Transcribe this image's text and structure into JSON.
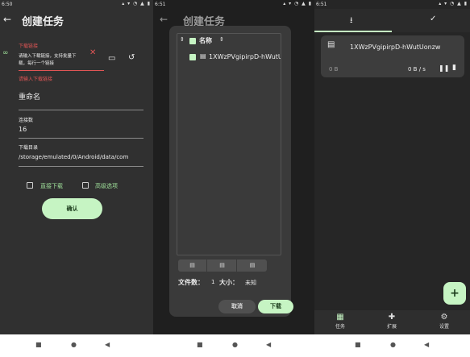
{
  "screen1": {
    "status_time": "6:50",
    "status_icons": "▴ ▾ ◔ ▲ ▮",
    "title": "创建任务",
    "download_link_label": "下载链接",
    "download_link_placeholder": "请输入下载链接，支持批量下载，每行一个链接",
    "download_link_error": "请输入下载链接",
    "rename_label": "重命名",
    "connections_label": "连接数",
    "connections_value": "16",
    "download_dir_label": "下载目录",
    "download_dir_value": "/storage/emulated/0/Android/data/com",
    "direct_download_label": "直接下载",
    "advanced_options_label": "高级选项",
    "confirm_label": "确认"
  },
  "screen2": {
    "status_time": "6:51",
    "status_icons": "▴ ▾ ◔ ▲ ▮",
    "title": "创建任务",
    "name_header": "名称",
    "file_name": "1XWzPVgipirpD-hWutU",
    "file_count_label": "文件数：",
    "file_count_value": "1",
    "size_label": "大小：",
    "size_value": "未知",
    "cancel_label": "取消",
    "download_label": "下载"
  },
  "screen3": {
    "status_time": "6:51",
    "status_icons": "▴ ▾ ◔ ▲ ▮",
    "task_name": "1XWzPVgipirpD-hWutUonzw",
    "task_size": "0 B",
    "task_speed": "0 B / s",
    "nav_tasks": "任务",
    "nav_extensions": "扩展",
    "nav_settings": "设置"
  },
  "colors": {
    "accent": "#c6f4c3",
    "error": "#e05555",
    "background": "#303030"
  },
  "icons": [
    "back-arrow-icon",
    "link-icon",
    "clear-icon",
    "folder-icon",
    "history-icon",
    "sort-icon",
    "file-icon",
    "download-icon",
    "check-icon",
    "pause-icon",
    "delete-icon",
    "add-icon",
    "tasks-icon",
    "extension-icon",
    "settings-icon"
  ]
}
